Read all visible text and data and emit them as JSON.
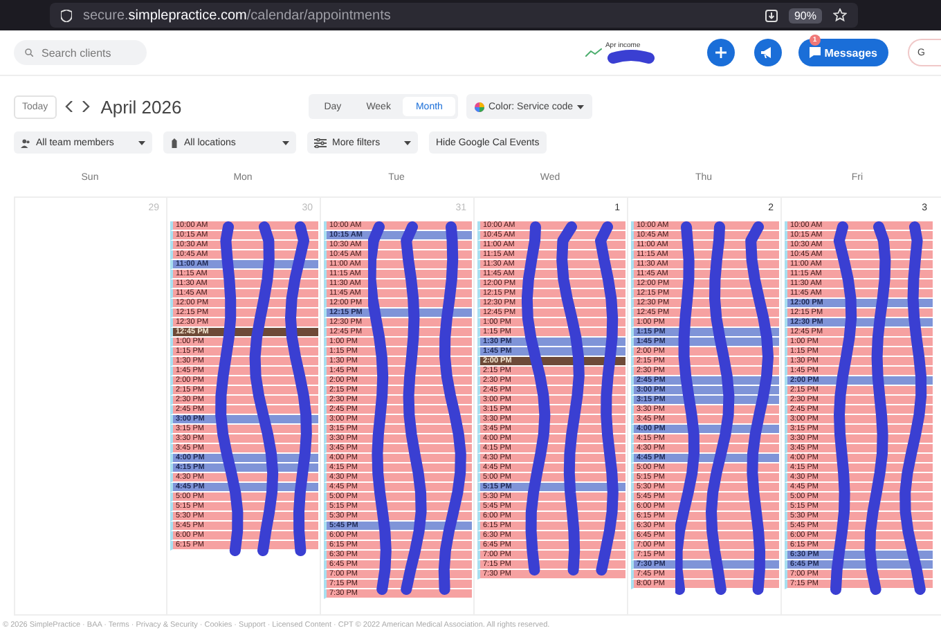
{
  "browser": {
    "address": "secure.**simplepractice.com**/calendar/appointments",
    "zoom": "90%"
  },
  "header": {
    "search": {
      "placeholder": "Search clients"
    },
    "income_label": "Apr income",
    "messages": {
      "label": "Messages",
      "badge": "1"
    },
    "account_button": "G"
  },
  "toolbar": {
    "today": "Today",
    "month": "April 2026",
    "views": [
      {
        "label": "Day",
        "selected": false
      },
      {
        "label": "Week",
        "selected": false
      },
      {
        "label": "Month",
        "selected": true
      }
    ],
    "color_filter": "Color: Service code"
  },
  "filters": [
    {
      "label": "All team members",
      "kind": "team"
    },
    {
      "label": "All locations",
      "kind": "location"
    },
    {
      "label": "More filters",
      "kind": "more"
    },
    {
      "label": "Hide Google Cal Events",
      "kind": "plain"
    }
  ],
  "calendar": {
    "weekdays": [
      "Sun",
      "Mon",
      "Tue",
      "Wed",
      "Thu",
      "Fri"
    ],
    "days": [
      {
        "date": "29",
        "in_month": false
      },
      {
        "date": "30",
        "in_month": false,
        "appointments": [
          {
            "time": "10:00 AM",
            "kind": "client"
          },
          {
            "time": "10:15 AM",
            "kind": "client"
          },
          {
            "time": "10:30 AM",
            "kind": "client"
          },
          {
            "time": "10:45 AM",
            "kind": "client"
          },
          {
            "time": "11:00 AM",
            "kind": "event"
          },
          {
            "time": "11:15 AM",
            "kind": "client"
          },
          {
            "time": "11:30 AM",
            "kind": "client"
          },
          {
            "time": "11:45 AM",
            "kind": "client"
          },
          {
            "time": "12:00 PM",
            "kind": "client"
          },
          {
            "time": "12:15 PM",
            "kind": "client"
          },
          {
            "time": "12:30 PM",
            "kind": "client"
          },
          {
            "time": "12:45 PM",
            "kind": "blocked"
          },
          {
            "time": "1:00 PM",
            "kind": "client"
          },
          {
            "time": "1:15 PM",
            "kind": "client"
          },
          {
            "time": "1:30 PM",
            "kind": "client"
          },
          {
            "time": "1:45 PM",
            "kind": "client"
          },
          {
            "time": "2:00 PM",
            "kind": "client"
          },
          {
            "time": "2:15 PM",
            "kind": "client"
          },
          {
            "time": "2:30 PM",
            "kind": "client"
          },
          {
            "time": "2:45 PM",
            "kind": "client"
          },
          {
            "time": "3:00 PM",
            "kind": "event"
          },
          {
            "time": "3:15 PM",
            "kind": "client"
          },
          {
            "time": "3:30 PM",
            "kind": "client"
          },
          {
            "time": "3:45 PM",
            "kind": "client"
          },
          {
            "time": "4:00 PM",
            "kind": "event"
          },
          {
            "time": "4:15 PM",
            "kind": "event"
          },
          {
            "time": "4:30 PM",
            "kind": "client"
          },
          {
            "time": "4:45 PM",
            "kind": "event"
          },
          {
            "time": "5:00 PM",
            "kind": "client"
          },
          {
            "time": "5:15 PM",
            "kind": "client"
          },
          {
            "time": "5:30 PM",
            "kind": "client"
          },
          {
            "time": "5:45 PM",
            "kind": "client"
          },
          {
            "time": "6:00 PM",
            "kind": "client"
          },
          {
            "time": "6:15 PM",
            "kind": "client"
          }
        ]
      },
      {
        "date": "31",
        "in_month": false,
        "appointments": [
          {
            "time": "10:00 AM",
            "kind": "client"
          },
          {
            "time": "10:15 AM",
            "kind": "event"
          },
          {
            "time": "10:30 AM",
            "kind": "client"
          },
          {
            "time": "10:45 AM",
            "kind": "client"
          },
          {
            "time": "11:00 AM",
            "kind": "client"
          },
          {
            "time": "11:15 AM",
            "kind": "client"
          },
          {
            "time": "11:30 AM",
            "kind": "client"
          },
          {
            "time": "11:45 AM",
            "kind": "client"
          },
          {
            "time": "12:00 PM",
            "kind": "client"
          },
          {
            "time": "12:15 PM",
            "kind": "event"
          },
          {
            "time": "12:30 PM",
            "kind": "client"
          },
          {
            "time": "12:45 PM",
            "kind": "client"
          },
          {
            "time": "1:00 PM",
            "kind": "client"
          },
          {
            "time": "1:15 PM",
            "kind": "client"
          },
          {
            "time": "1:30 PM",
            "kind": "client"
          },
          {
            "time": "1:45 PM",
            "kind": "client"
          },
          {
            "time": "2:00 PM",
            "kind": "client"
          },
          {
            "time": "2:15 PM",
            "kind": "client"
          },
          {
            "time": "2:30 PM",
            "kind": "client"
          },
          {
            "time": "2:45 PM",
            "kind": "client"
          },
          {
            "time": "3:00 PM",
            "kind": "client"
          },
          {
            "time": "3:15 PM",
            "kind": "client"
          },
          {
            "time": "3:30 PM",
            "kind": "client"
          },
          {
            "time": "3:45 PM",
            "kind": "client"
          },
          {
            "time": "4:00 PM",
            "kind": "client"
          },
          {
            "time": "4:15 PM",
            "kind": "client"
          },
          {
            "time": "4:30 PM",
            "kind": "client"
          },
          {
            "time": "4:45 PM",
            "kind": "client"
          },
          {
            "time": "5:00 PM",
            "kind": "client"
          },
          {
            "time": "5:15 PM",
            "kind": "client"
          },
          {
            "time": "5:30 PM",
            "kind": "client"
          },
          {
            "time": "5:45 PM",
            "kind": "event"
          },
          {
            "time": "6:00 PM",
            "kind": "client"
          },
          {
            "time": "6:15 PM",
            "kind": "client"
          },
          {
            "time": "6:30 PM",
            "kind": "client"
          },
          {
            "time": "6:45 PM",
            "kind": "client"
          },
          {
            "time": "7:00 PM",
            "kind": "client"
          },
          {
            "time": "7:15 PM",
            "kind": "client"
          },
          {
            "time": "7:30 PM",
            "kind": "client"
          }
        ]
      },
      {
        "date": "1",
        "in_month": true,
        "appointments": [
          {
            "time": "10:00 AM",
            "kind": "client"
          },
          {
            "time": "10:45 AM",
            "kind": "client"
          },
          {
            "time": "11:00 AM",
            "kind": "client"
          },
          {
            "time": "11:15 AM",
            "kind": "client"
          },
          {
            "time": "11:30 AM",
            "kind": "client"
          },
          {
            "time": "11:45 AM",
            "kind": "client"
          },
          {
            "time": "12:00 PM",
            "kind": "client"
          },
          {
            "time": "12:15 PM",
            "kind": "client"
          },
          {
            "time": "12:30 PM",
            "kind": "client"
          },
          {
            "time": "12:45 PM",
            "kind": "client"
          },
          {
            "time": "1:00 PM",
            "kind": "client"
          },
          {
            "time": "1:15 PM",
            "kind": "client"
          },
          {
            "time": "1:30 PM",
            "kind": "event"
          },
          {
            "time": "1:45 PM",
            "kind": "event"
          },
          {
            "time": "2:00 PM",
            "kind": "blocked"
          },
          {
            "time": "2:15 PM",
            "kind": "client"
          },
          {
            "time": "2:30 PM",
            "kind": "client"
          },
          {
            "time": "2:45 PM",
            "kind": "client"
          },
          {
            "time": "3:00 PM",
            "kind": "client"
          },
          {
            "time": "3:15 PM",
            "kind": "client"
          },
          {
            "time": "3:30 PM",
            "kind": "client"
          },
          {
            "time": "3:45 PM",
            "kind": "client"
          },
          {
            "time": "4:00 PM",
            "kind": "client"
          },
          {
            "time": "4:15 PM",
            "kind": "client"
          },
          {
            "time": "4:30 PM",
            "kind": "client"
          },
          {
            "time": "4:45 PM",
            "kind": "client"
          },
          {
            "time": "5:00 PM",
            "kind": "client"
          },
          {
            "time": "5:15 PM",
            "kind": "event"
          },
          {
            "time": "5:30 PM",
            "kind": "client"
          },
          {
            "time": "5:45 PM",
            "kind": "client"
          },
          {
            "time": "6:00 PM",
            "kind": "client"
          },
          {
            "time": "6:15 PM",
            "kind": "client"
          },
          {
            "time": "6:30 PM",
            "kind": "client"
          },
          {
            "time": "6:45 PM",
            "kind": "client"
          },
          {
            "time": "7:00 PM",
            "kind": "client"
          },
          {
            "time": "7:15 PM",
            "kind": "client"
          },
          {
            "time": "7:30 PM",
            "kind": "client"
          }
        ]
      },
      {
        "date": "2",
        "in_month": true,
        "appointments": [
          {
            "time": "10:00 AM",
            "kind": "client"
          },
          {
            "time": "10:45 AM",
            "kind": "client"
          },
          {
            "time": "11:00 AM",
            "kind": "client"
          },
          {
            "time": "11:15 AM",
            "kind": "client"
          },
          {
            "time": "11:30 AM",
            "kind": "client"
          },
          {
            "time": "11:45 AM",
            "kind": "client"
          },
          {
            "time": "12:00 PM",
            "kind": "client"
          },
          {
            "time": "12:15 PM",
            "kind": "client"
          },
          {
            "time": "12:30 PM",
            "kind": "client"
          },
          {
            "time": "12:45 PM",
            "kind": "client"
          },
          {
            "time": "1:00 PM",
            "kind": "client"
          },
          {
            "time": "1:15 PM",
            "kind": "event"
          },
          {
            "time": "1:45 PM",
            "kind": "event"
          },
          {
            "time": "2:00 PM",
            "kind": "client"
          },
          {
            "time": "2:15 PM",
            "kind": "client"
          },
          {
            "time": "2:30 PM",
            "kind": "client"
          },
          {
            "time": "2:45 PM",
            "kind": "event"
          },
          {
            "time": "3:00 PM",
            "kind": "event"
          },
          {
            "time": "3:15 PM",
            "kind": "event"
          },
          {
            "time": "3:30 PM",
            "kind": "client"
          },
          {
            "time": "3:45 PM",
            "kind": "client"
          },
          {
            "time": "4:00 PM",
            "kind": "event"
          },
          {
            "time": "4:15 PM",
            "kind": "client"
          },
          {
            "time": "4:30 PM",
            "kind": "client"
          },
          {
            "time": "4:45 PM",
            "kind": "event"
          },
          {
            "time": "5:00 PM",
            "kind": "client"
          },
          {
            "time": "5:15 PM",
            "kind": "client"
          },
          {
            "time": "5:30 PM",
            "kind": "client"
          },
          {
            "time": "5:45 PM",
            "kind": "client"
          },
          {
            "time": "6:00 PM",
            "kind": "client"
          },
          {
            "time": "6:15 PM",
            "kind": "client"
          },
          {
            "time": "6:30 PM",
            "kind": "client"
          },
          {
            "time": "6:45 PM",
            "kind": "client"
          },
          {
            "time": "7:00 PM",
            "kind": "client"
          },
          {
            "time": "7:15 PM",
            "kind": "client"
          },
          {
            "time": "7:30 PM",
            "kind": "event"
          },
          {
            "time": "7:45 PM",
            "kind": "client"
          },
          {
            "time": "8:00 PM",
            "kind": "client"
          }
        ]
      },
      {
        "date": "3",
        "in_month": true,
        "appointments": [
          {
            "time": "10:00 AM",
            "kind": "client"
          },
          {
            "time": "10:15 AM",
            "kind": "client"
          },
          {
            "time": "10:30 AM",
            "kind": "client"
          },
          {
            "time": "10:45 AM",
            "kind": "client"
          },
          {
            "time": "11:00 AM",
            "kind": "client"
          },
          {
            "time": "11:15 AM",
            "kind": "client"
          },
          {
            "time": "11:30 AM",
            "kind": "client"
          },
          {
            "time": "11:45 AM",
            "kind": "client"
          },
          {
            "time": "12:00 PM",
            "kind": "event"
          },
          {
            "time": "12:15 PM",
            "kind": "client"
          },
          {
            "time": "12:30 PM",
            "kind": "event"
          },
          {
            "time": "12:45 PM",
            "kind": "client"
          },
          {
            "time": "1:00 PM",
            "kind": "client"
          },
          {
            "time": "1:15 PM",
            "kind": "client"
          },
          {
            "time": "1:30 PM",
            "kind": "client"
          },
          {
            "time": "1:45 PM",
            "kind": "client"
          },
          {
            "time": "2:00 PM",
            "kind": "event"
          },
          {
            "time": "2:15 PM",
            "kind": "client"
          },
          {
            "time": "2:30 PM",
            "kind": "client"
          },
          {
            "time": "2:45 PM",
            "kind": "client"
          },
          {
            "time": "3:00 PM",
            "kind": "client"
          },
          {
            "time": "3:15 PM",
            "kind": "client"
          },
          {
            "time": "3:30 PM",
            "kind": "client"
          },
          {
            "time": "3:45 PM",
            "kind": "client"
          },
          {
            "time": "4:00 PM",
            "kind": "client"
          },
          {
            "time": "4:15 PM",
            "kind": "client"
          },
          {
            "time": "4:30 PM",
            "kind": "client"
          },
          {
            "time": "4:45 PM",
            "kind": "client"
          },
          {
            "time": "5:00 PM",
            "kind": "client"
          },
          {
            "time": "5:15 PM",
            "kind": "client"
          },
          {
            "time": "5:30 PM",
            "kind": "client"
          },
          {
            "time": "5:45 PM",
            "kind": "client"
          },
          {
            "time": "6:00 PM",
            "kind": "client"
          },
          {
            "time": "6:15 PM",
            "kind": "client"
          },
          {
            "time": "6:30 PM",
            "kind": "event"
          },
          {
            "time": "6:45 PM",
            "kind": "event"
          },
          {
            "time": "7:00 PM",
            "kind": "client"
          },
          {
            "time": "7:15 PM",
            "kind": "client"
          }
        ]
      }
    ]
  },
  "footer": "© 2026 SimplePractice · BAA · Terms · Privacy & Security · Cookies · Support · Licensed Content · CPT © 2022 American Medical Association. All rights reserved."
}
